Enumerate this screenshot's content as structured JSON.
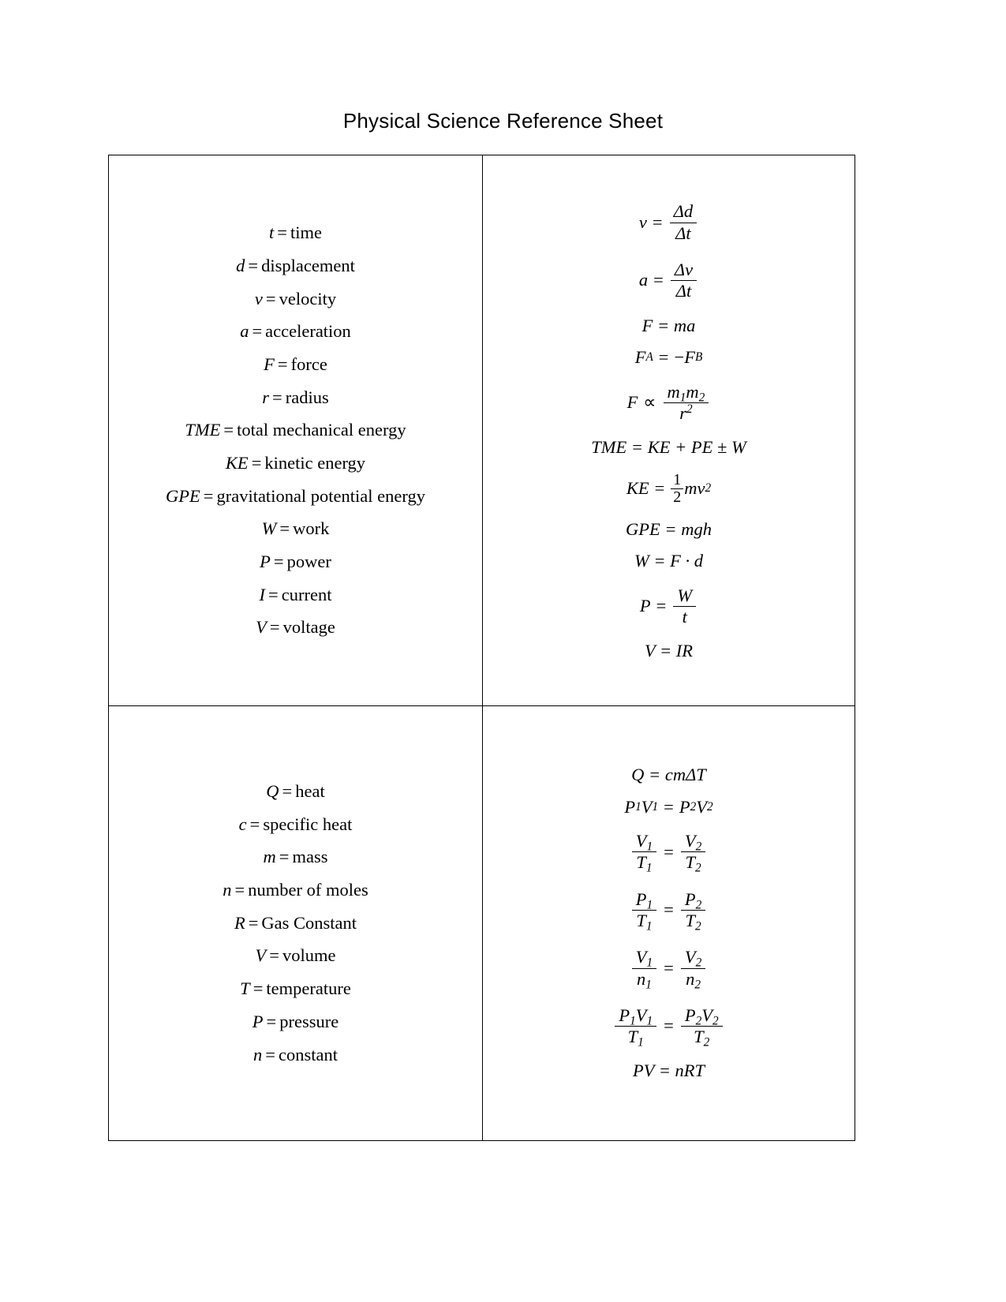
{
  "document": {
    "title": "Physical Science Reference Sheet"
  },
  "table": {
    "mechanics": {
      "variables": [
        {
          "symbol": "t",
          "equals": "=",
          "meaning": "time"
        },
        {
          "symbol": "d",
          "equals": "=",
          "meaning": "displacement"
        },
        {
          "symbol": "v",
          "equals": "=",
          "meaning": "velocity"
        },
        {
          "symbol": "a",
          "equals": "=",
          "meaning": "acceleration"
        },
        {
          "symbol": "F",
          "equals": "=",
          "meaning": "force"
        },
        {
          "symbol": "r",
          "equals": "=",
          "meaning": "radius"
        },
        {
          "symbol": "TME",
          "equals": "=",
          "meaning": "total mechanical energy"
        },
        {
          "symbol": "KE",
          "equals": "=",
          "meaning": "kinetic energy"
        },
        {
          "symbol": "GPE",
          "equals": "=",
          "meaning": "gravitational potential energy"
        },
        {
          "symbol": "W",
          "equals": "=",
          "meaning": "work"
        },
        {
          "symbol": "P",
          "equals": "=",
          "meaning": "power"
        },
        {
          "symbol": "I",
          "equals": "=",
          "meaning": "current"
        },
        {
          "symbol": "V",
          "equals": "=",
          "meaning": "voltage"
        }
      ],
      "equations": {
        "velocity": {
          "lhs": "v",
          "op": "=",
          "num": "Δd",
          "den": "Δt"
        },
        "acceleration": {
          "lhs": "a",
          "op": "=",
          "num": "Δv",
          "den": "Δt"
        },
        "newton_second": {
          "text": "F = ma"
        },
        "newton_third": {
          "lhs_base": "F",
          "lhs_sub": "A",
          "op": "=",
          "rhs_sign": "−",
          "rhs_base": "F",
          "rhs_sub": "B"
        },
        "gravitation": {
          "lhs": "F",
          "op": "∝",
          "num_m1": "m",
          "num_sub1": "1",
          "num_m2": "m",
          "num_sub2": "2",
          "den_base": "r",
          "den_exp": "2"
        },
        "total_mech": {
          "text": "TME = KE + PE ± W"
        },
        "kinetic": {
          "lhs": "KE",
          "op": "=",
          "num": "1",
          "den": "2",
          "tail_m": "m",
          "tail_v": "v",
          "tail_exp": "2"
        },
        "gpe": {
          "text": "GPE = mgh"
        },
        "work": {
          "text": "W = F · d"
        },
        "power": {
          "lhs": "P",
          "op": "=",
          "num": "W",
          "den": "t"
        },
        "ohms_law": {
          "text": "V = IR"
        }
      }
    },
    "gases": {
      "variables": [
        {
          "symbol": "Q",
          "equals": "=",
          "meaning": "heat"
        },
        {
          "symbol": "c",
          "equals": "=",
          "meaning": "specific heat"
        },
        {
          "symbol": "m",
          "equals": "=",
          "meaning": "mass"
        },
        {
          "symbol": "n",
          "equals": "=",
          "meaning": "number of moles"
        },
        {
          "symbol": "R",
          "equals": "=",
          "meaning": "Gas Constant"
        },
        {
          "symbol": "V",
          "equals": "=",
          "meaning": "volume"
        },
        {
          "symbol": "T",
          "equals": "=",
          "meaning": "temperature"
        },
        {
          "symbol": "P",
          "equals": "=",
          "meaning": "pressure"
        },
        {
          "symbol": "n",
          "equals": "=",
          "meaning": "constant"
        }
      ],
      "equations": {
        "heat": {
          "text": "Q = cmΔT"
        },
        "boyle": {
          "l1": "P",
          "l1s": "1",
          "l2": "V",
          "l2s": "1",
          "op": "=",
          "r1": "P",
          "r1s": "2",
          "r2": "V",
          "r2s": "2"
        },
        "charles": {
          "ln": "V",
          "lns": "1",
          "ld": "T",
          "lds": "1",
          "op": "=",
          "rn": "V",
          "rns": "2",
          "rd": "T",
          "rds": "2"
        },
        "gay_lussac": {
          "ln": "P",
          "lns": "1",
          "ld": "T",
          "lds": "1",
          "op": "=",
          "rn": "P",
          "rns": "2",
          "rd": "T",
          "rds": "2"
        },
        "avogadro": {
          "ln": "V",
          "lns": "1",
          "ld": "n",
          "lds": "1",
          "op": "=",
          "rn": "V",
          "rns": "2",
          "rd": "n",
          "rds": "2"
        },
        "combined": {
          "ln1": "P",
          "ln1s": "1",
          "ln2": "V",
          "ln2s": "1",
          "ld": "T",
          "lds": "1",
          "op": "=",
          "rn1": "P",
          "rn1s": "2",
          "rn2": "V",
          "rn2s": "2",
          "rd": "T",
          "rds": "2"
        },
        "ideal_gas": {
          "text": "PV = nRT"
        }
      }
    }
  }
}
